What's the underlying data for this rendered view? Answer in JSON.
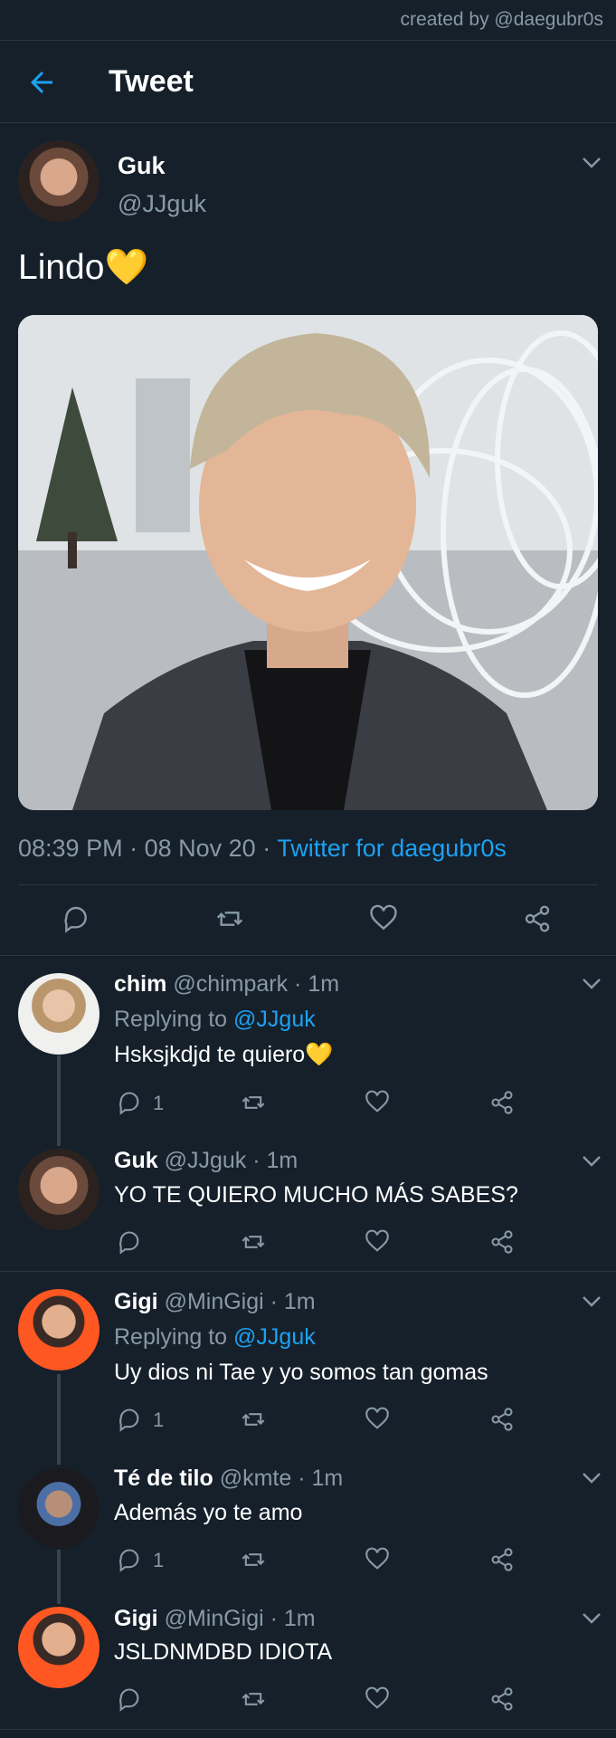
{
  "credit": "created by @daegubr0s",
  "header": {
    "title": "Tweet",
    "back_icon": "arrow-left-icon"
  },
  "main_tweet": {
    "name": "Guk",
    "handle": "@JJguk",
    "text": "Lindo",
    "emoji": "💛",
    "time": "08:39 PM",
    "date": "08 Nov 20",
    "source": "Twitter for daegubr0s"
  },
  "colors": {
    "background": "#15202b",
    "accent": "#1da1f2",
    "muted": "#8899a6",
    "divider": "#2b3640"
  },
  "replies": [
    {
      "name": "chim",
      "handle": "@chimpark",
      "time": "1m",
      "replying_label": "Replying to",
      "replying_to": "@JJguk",
      "text": "Hsksjkdjd te quiero",
      "emoji": "💛",
      "reply_count": "1"
    },
    {
      "name": "Guk",
      "handle": "@JJguk",
      "time": "1m",
      "text": "YO TE QUIERO MUCHO MÁS SABES?"
    },
    {
      "name": "Gigi",
      "handle": "@MinGigi",
      "time": "1m",
      "replying_label": "Replying to",
      "replying_to": "@JJguk",
      "text": "Uy dios ni Tae y yo somos tan gomas",
      "reply_count": "1"
    },
    {
      "name": "Té de tilo",
      "handle": "@kmte",
      "time": "1m",
      "text": "Además yo te amo",
      "reply_count": "1"
    },
    {
      "name": "Gigi",
      "handle": "@MinGigi",
      "time": "1m",
      "text": "JSLDNMDBD IDIOTA"
    }
  ]
}
